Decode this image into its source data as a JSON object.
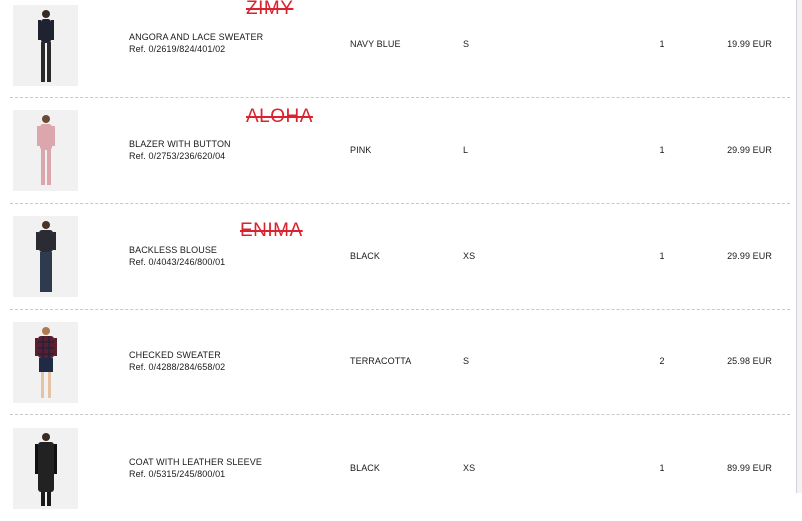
{
  "order_items": [
    {
      "name": "ANGORA AND LACE SWEATER",
      "ref": "Ref. 0/2619/824/401/02",
      "color": "NAVY BLUE",
      "size": "S",
      "qty": "1",
      "price": "19.99 EUR",
      "stamp": "ZIMY",
      "swatch": "#1f2230"
    },
    {
      "name": "BLAZER WITH BUTTON",
      "ref": "Ref. 0/2753/236/620/04",
      "color": "PINK",
      "size": "L",
      "qty": "1",
      "price": "29.99 EUR",
      "stamp": "ALOHA",
      "swatch": "#dca7ac"
    },
    {
      "name": "BACKLESS BLOUSE",
      "ref": "Ref. 0/4043/246/800/01",
      "color": "BLACK",
      "size": "XS",
      "qty": "1",
      "price": "29.99 EUR",
      "stamp": "ENIMA",
      "swatch": "#2a2b33"
    },
    {
      "name": "CHECKED SWEATER",
      "ref": "Ref. 0/4288/284/658/02",
      "color": "TERRACOTTA",
      "size": "S",
      "qty": "2",
      "price": "25.98 EUR",
      "stamp": "",
      "swatch": "#5a1f2e"
    },
    {
      "name": "COAT WITH LEATHER SLEEVE",
      "ref": "Ref. 0/5315/245/800/01",
      "color": "BLACK",
      "size": "XS",
      "qty": "1",
      "price": "89.99 EUR",
      "stamp": "",
      "swatch": "#222222"
    }
  ]
}
